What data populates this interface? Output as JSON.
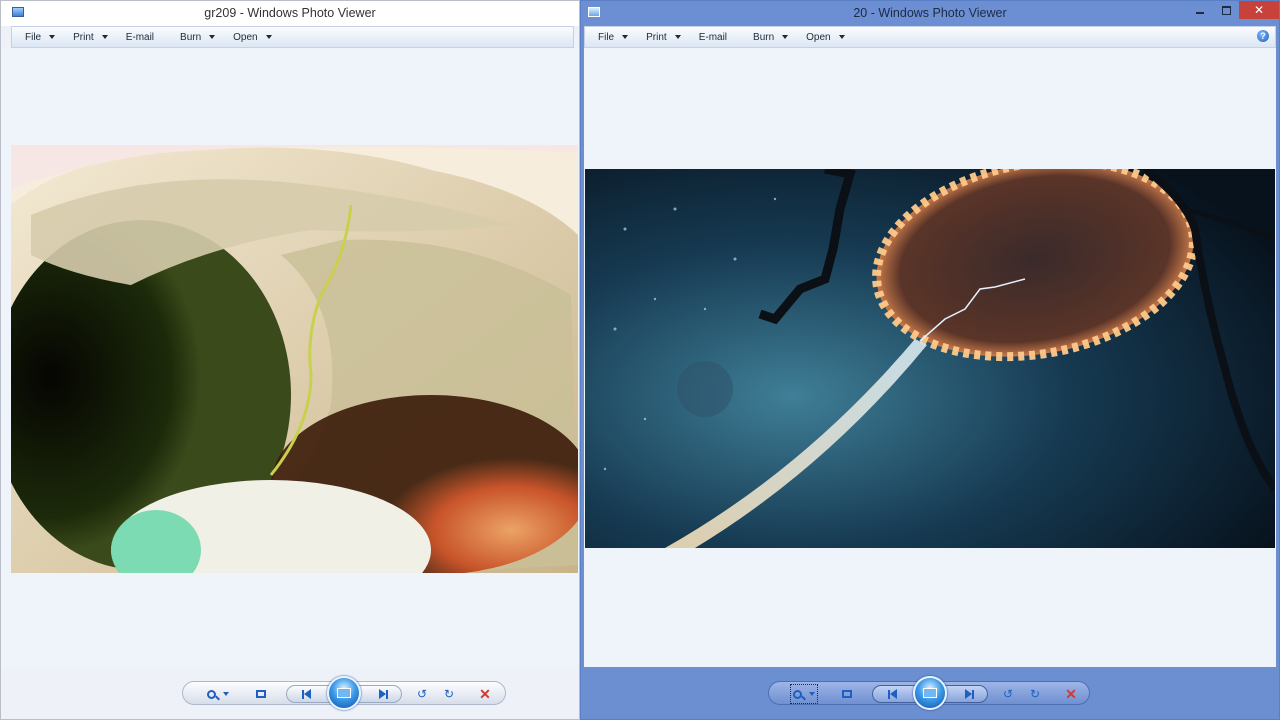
{
  "left_window": {
    "title": "gr209 - Windows Photo Viewer",
    "menu": [
      {
        "label": "File"
      },
      {
        "label": "Print"
      },
      {
        "label": "E-mail"
      },
      {
        "label": "Burn"
      },
      {
        "label": "Open"
      }
    ],
    "photo_name": "gr209",
    "controls": [
      "zoom-icon",
      "actual-size-icon",
      "previous-icon",
      "slideshow-icon",
      "next-icon",
      "rotate-counterclockwise-icon",
      "rotate-clockwise-icon",
      "delete-icon"
    ]
  },
  "right_window": {
    "title": "20 - Windows Photo Viewer",
    "menu": [
      {
        "label": "File"
      },
      {
        "label": "Print"
      },
      {
        "label": "E-mail"
      },
      {
        "label": "Burn"
      },
      {
        "label": "Open"
      }
    ],
    "help_label": "?",
    "window_controls": {
      "minimize": "",
      "maximize": "",
      "close": "✕"
    },
    "photo_name": "20"
  },
  "colors": {
    "accent": "#1f5fbf",
    "delete": "#d23a2e",
    "active_frame": "#6b8fd1"
  }
}
